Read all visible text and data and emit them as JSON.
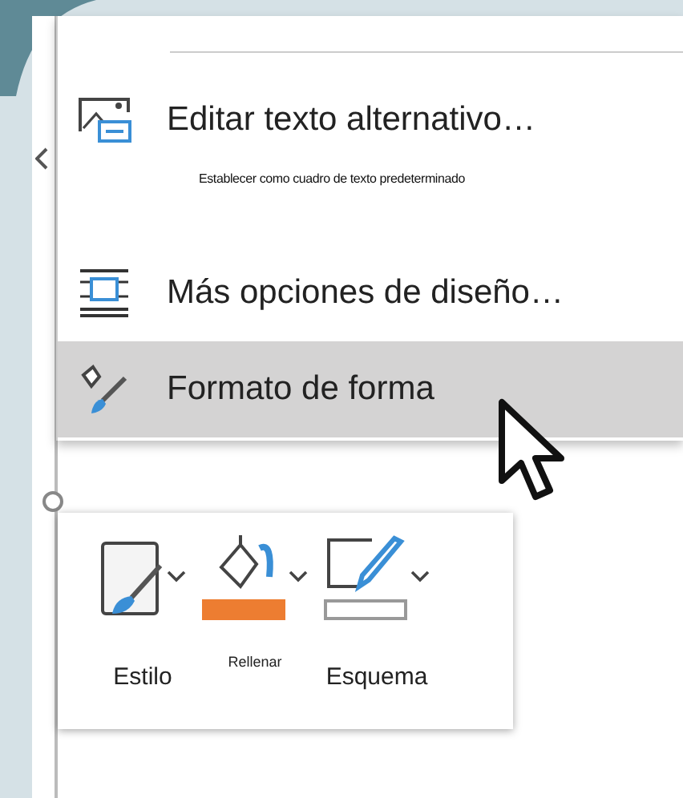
{
  "context_menu": {
    "items": [
      {
        "kind": "item",
        "label": "Editar texto alternativo…",
        "selected": false
      },
      {
        "kind": "note",
        "label": "Establecer como cuadro de texto predeterminado"
      },
      {
        "kind": "item",
        "label": "Más opciones de diseño…",
        "selected": false
      },
      {
        "kind": "item",
        "label": "Formato de forma",
        "selected": true
      }
    ]
  },
  "mini_toolbar": {
    "buttons": [
      {
        "kind": "style",
        "label": "Estilo"
      },
      {
        "kind": "fill",
        "label": "Rellenar",
        "color": "#ed7d31"
      },
      {
        "kind": "outline",
        "label": "Esquema",
        "color": "#ffffff"
      }
    ]
  }
}
